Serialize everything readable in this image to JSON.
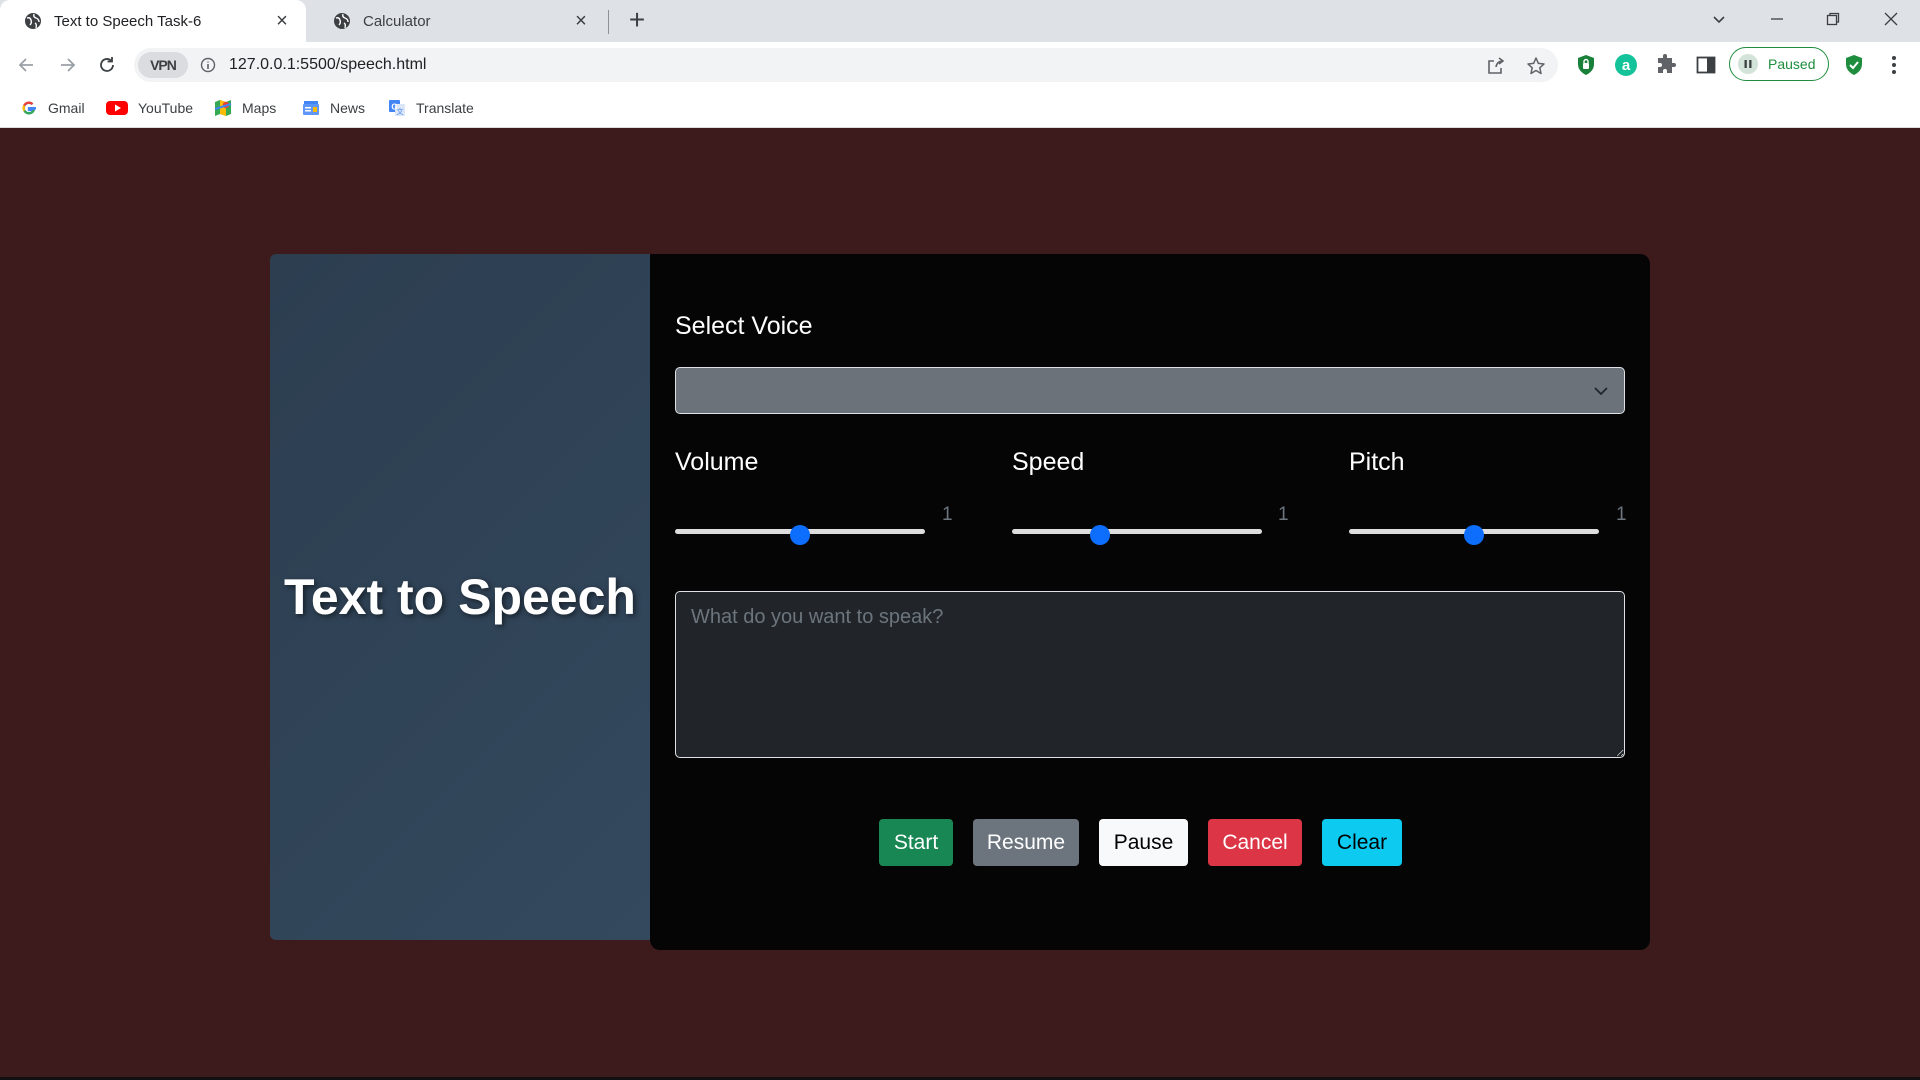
{
  "browser": {
    "tabs": [
      {
        "title": "Text to Speech Task-6",
        "active": true
      },
      {
        "title": "Calculator",
        "active": false
      }
    ],
    "url": "127.0.0.1:5500/speech.html",
    "vpn_label": "VPN",
    "profile_status": "Paused",
    "bookmarks": [
      {
        "label": "Gmail",
        "icon": "google-icon"
      },
      {
        "label": "YouTube",
        "icon": "youtube-icon"
      },
      {
        "label": "Maps",
        "icon": "maps-icon"
      },
      {
        "label": "News",
        "icon": "news-icon"
      },
      {
        "label": "Translate",
        "icon": "translate-icon"
      }
    ]
  },
  "page": {
    "hero_title": "Text to Speech",
    "select_voice_label": "Select Voice",
    "select_voice_value": "",
    "sliders": {
      "volume": {
        "label": "Volume",
        "value": "1",
        "fraction": 0.5
      },
      "speed": {
        "label": "Speed",
        "value": "1",
        "fraction": 0.35
      },
      "pitch": {
        "label": "Pitch",
        "value": "1",
        "fraction": 0.5
      }
    },
    "textarea_placeholder": "What do you want to speak?",
    "buttons": {
      "start": "Start",
      "resume": "Resume",
      "pause": "Pause",
      "cancel": "Cancel",
      "clear": "Clear"
    }
  },
  "colors": {
    "page_bg": "#3d1b1c",
    "left_panel": "#2c3e50",
    "right_panel": "#050505",
    "slider_thumb": "#0d6efd",
    "start": "#198754",
    "resume": "#6c757d",
    "pause": "#f8f9fa",
    "cancel": "#dc3545",
    "clear": "#0dcaf0"
  }
}
